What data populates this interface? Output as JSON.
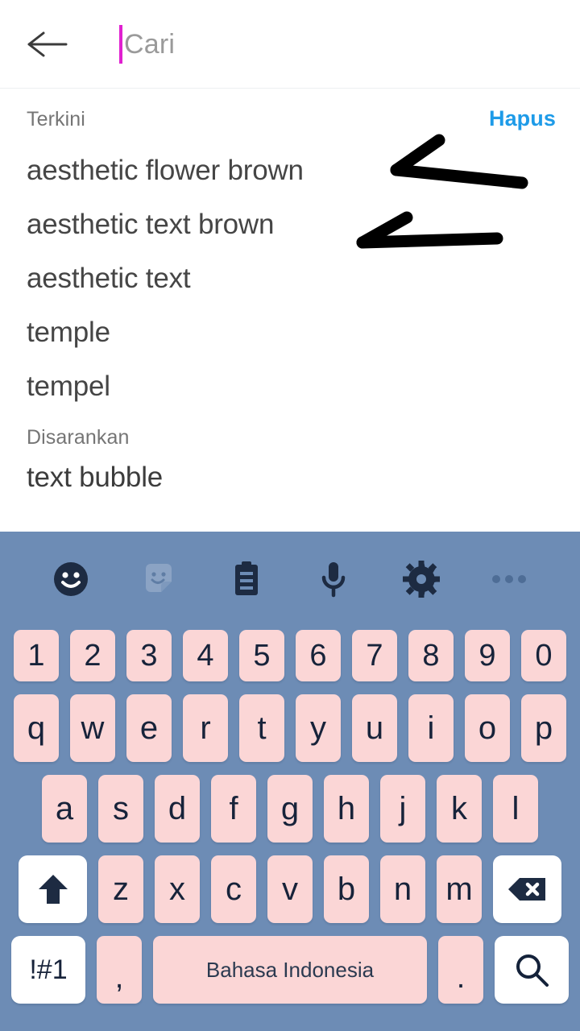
{
  "header": {
    "back_icon": "arrow-left-icon",
    "search_value": "",
    "search_placeholder": "Cari",
    "caret_color": "#e020d0"
  },
  "suggestions": {
    "recent_label": "Terkini",
    "clear_label": "Hapus",
    "clear_color": "#1e9be8",
    "recent_items": [
      {
        "label": "aesthetic flower brown"
      },
      {
        "label": "aesthetic text brown"
      },
      {
        "label": "aesthetic text"
      },
      {
        "label": "temple"
      },
      {
        "label": "tempel"
      }
    ],
    "suggested_label": "Disarankan",
    "suggested_items": [
      {
        "label": "text bubble"
      }
    ],
    "annotations": [
      {
        "name": "arrow-pointing-to-item-1",
        "target": "aesthetic flower brown"
      },
      {
        "name": "arrow-pointing-to-item-2",
        "target": "aesthetic text brown"
      }
    ]
  },
  "keyboard": {
    "background_color": "#6d8cb5",
    "key_color": "#fbd6d6",
    "special_key_color": "#ffffff",
    "toolbar": [
      {
        "icon": "emoji-icon",
        "label": "Emoji"
      },
      {
        "icon": "sticker-icon",
        "label": "Stiker"
      },
      {
        "icon": "clipboard-icon",
        "label": "Clipboard"
      },
      {
        "icon": "microphone-icon",
        "label": "Suara"
      },
      {
        "icon": "gear-icon",
        "label": "Pengaturan"
      },
      {
        "icon": "more-horizontal-icon",
        "label": "Lainnya"
      }
    ],
    "row_numbers": [
      "1",
      "2",
      "3",
      "4",
      "5",
      "6",
      "7",
      "8",
      "9",
      "0"
    ],
    "row_top": [
      "q",
      "w",
      "e",
      "r",
      "t",
      "y",
      "u",
      "i",
      "o",
      "p"
    ],
    "row_home": [
      "a",
      "s",
      "d",
      "f",
      "g",
      "h",
      "j",
      "k",
      "l"
    ],
    "row_bottom": [
      "z",
      "x",
      "c",
      "v",
      "b",
      "n",
      "m"
    ],
    "shift_key": {
      "icon": "shift-arrow-up-icon",
      "label": "Shift"
    },
    "backspace_key": {
      "icon": "backspace-icon",
      "label": "Backspace"
    },
    "symbols_key": {
      "label": "!#1"
    },
    "comma_key": {
      "label": ","
    },
    "space_key": {
      "label": "Bahasa Indonesia"
    },
    "period_key": {
      "label": "."
    },
    "search_key": {
      "icon": "search-icon",
      "label": "Cari"
    }
  }
}
